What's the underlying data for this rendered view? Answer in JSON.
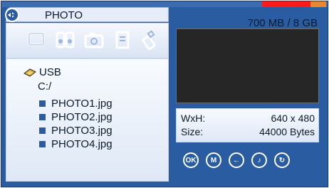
{
  "header": {
    "title": "PHOTO",
    "storage": "700 MB / 8 GB",
    "storage_used_fraction": 0.0875
  },
  "categories": [
    {
      "name": "photo-frame-icon"
    },
    {
      "name": "speakers-icon"
    },
    {
      "name": "camera-icon"
    },
    {
      "name": "document-icon"
    },
    {
      "name": "usb-stick-icon"
    }
  ],
  "browser": {
    "device": "USB",
    "path": "C:/",
    "files": [
      "PHOTO1.jpg",
      "PHOTO2.jpg",
      "PHOTO3.jpg",
      "PHOTO4.jpg"
    ]
  },
  "info": {
    "size_dims_label": "WxH:",
    "size_dims_value": "640 x 480",
    "filesize_label": "Size:",
    "filesize_value": "44000 Bytes"
  },
  "controls": [
    {
      "name": "ok-button",
      "label": "OK"
    },
    {
      "name": "menu-button",
      "label": "M"
    },
    {
      "name": "back-button",
      "label": "←"
    },
    {
      "name": "volume-button",
      "label": "♪"
    },
    {
      "name": "rotate-button",
      "label": "↻"
    }
  ],
  "colors": {
    "background": "#2a5ca2",
    "capacity_used": "#ff1a1a",
    "capacity_free": "#e7882d",
    "panel": "#e6edf8"
  }
}
